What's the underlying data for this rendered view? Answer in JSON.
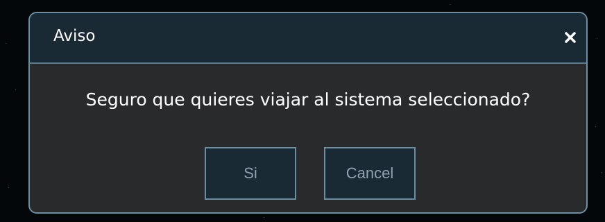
{
  "dialog": {
    "title": "Aviso",
    "close_icon": "close-icon",
    "message": "Seguro que quieres viajar al sistema seleccionado?",
    "buttons": {
      "yes_label": "Si",
      "cancel_label": "Cancel"
    }
  },
  "colors": {
    "background": "#04070a",
    "dialog_body": "#292a2b",
    "dialog_header": "#1a2a35",
    "border": "#6a8ea2",
    "title_text": "#ffffff",
    "button_text": "#8ea3af"
  }
}
